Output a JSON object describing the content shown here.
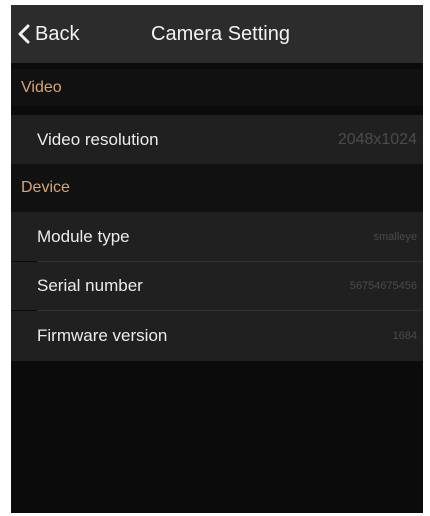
{
  "header": {
    "back_label": "Back",
    "back_icon": "chevron-left-icon",
    "title": "Camera Setting"
  },
  "sections": [
    {
      "title": "Video",
      "items": [
        {
          "label": "Video resolution",
          "value": "2048x1024"
        }
      ]
    },
    {
      "title": "Device",
      "items": [
        {
          "label": "Module type",
          "value": "smalleye"
        },
        {
          "label": "Serial number",
          "value": "56754675456"
        },
        {
          "label": "Firmware version",
          "value": "1684"
        }
      ]
    }
  ],
  "colors": {
    "background": "#0b0b0b",
    "header_bar": "#2c2c2c",
    "section_title": "#d9a572",
    "row_background": "#202020",
    "value_text": "#4b4b4b"
  }
}
